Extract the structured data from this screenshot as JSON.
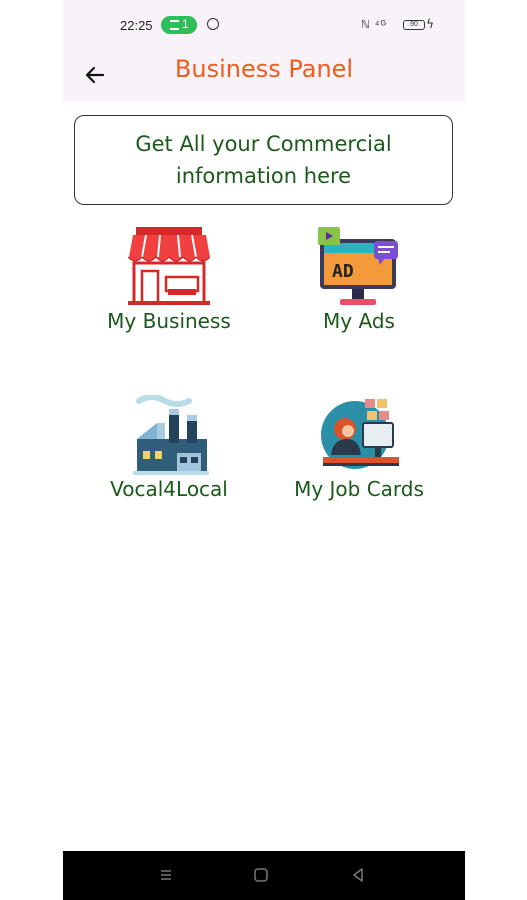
{
  "status_bar": {
    "time": "22:25",
    "pill_number": "1",
    "battery": "90",
    "right_icons": "ℕ ⁴ᴳ"
  },
  "app_bar": {
    "title": "Business Panel",
    "title_color": "#f05a1a"
  },
  "info_card": {
    "text": "Get All your Commercial information here"
  },
  "tiles": [
    {
      "label": "My Business",
      "icon": "shop-icon"
    },
    {
      "label": "My Ads",
      "icon": "ad-monitor-icon"
    },
    {
      "label": "Vocal4Local",
      "icon": "factory-icon"
    },
    {
      "label": "My Job Cards",
      "icon": "worker-desk-icon"
    }
  ],
  "colors": {
    "label_green": "#1a5a1a",
    "accent_orange": "#f05a1a",
    "status_green": "#2ebd59"
  }
}
